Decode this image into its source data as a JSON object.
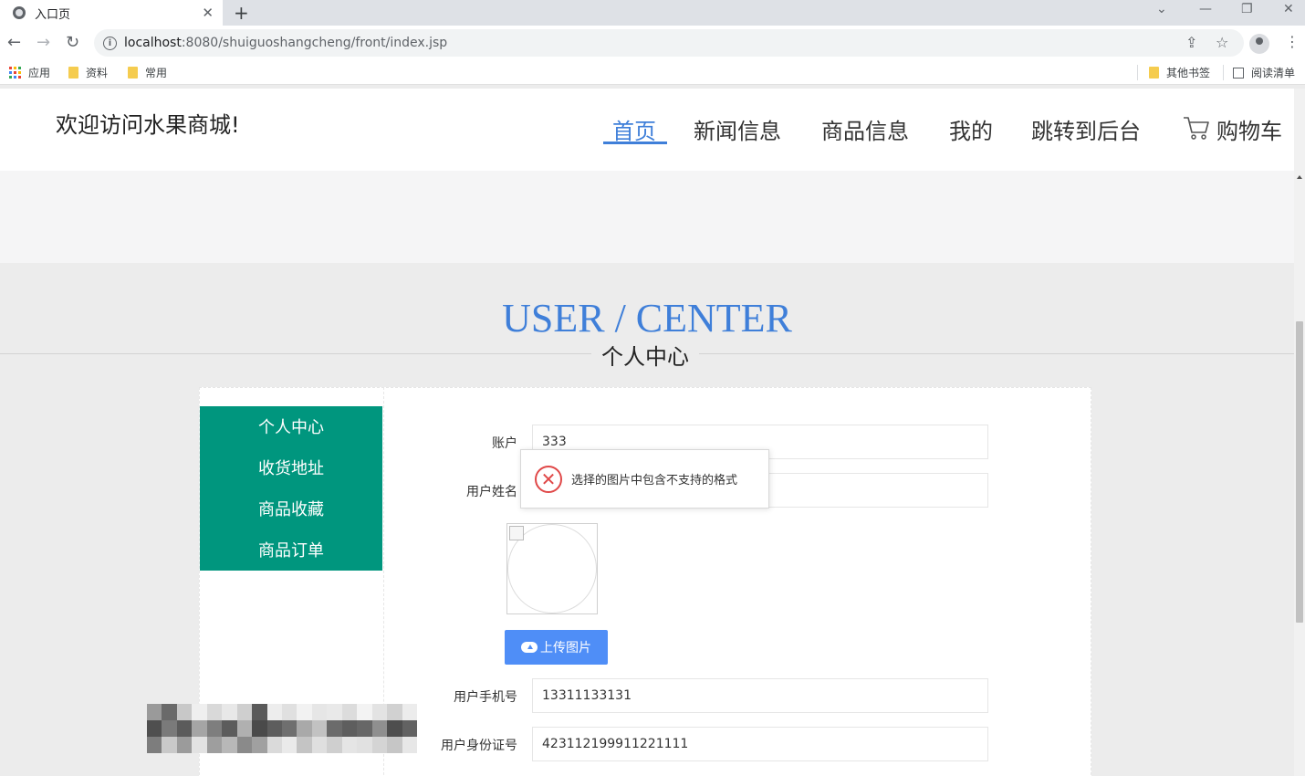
{
  "browser": {
    "tab_title": "入口页",
    "tab_close": "✕",
    "new_tab": "+",
    "url_host": "localhost",
    "url_path": ":8080/shuiguoshangcheng/front/index.jsp",
    "bookmarks": [
      "应用",
      "资料",
      "常用"
    ],
    "bookmark_other": "其他书签",
    "reading_list": "阅读清单"
  },
  "header": {
    "welcome": "欢迎访问水果商城!",
    "nav": [
      "首页",
      "新闻信息",
      "商品信息",
      "我的",
      "跳转到后台",
      "购物车"
    ],
    "active_index": 0,
    "accent": "#3f7fd9"
  },
  "section": {
    "title_en": "USER / CENTER",
    "title_cn": "个人中心"
  },
  "sidebar": {
    "items": [
      "个人中心",
      "收货地址",
      "商品收藏",
      "商品订单"
    ],
    "color": "#00967e"
  },
  "form": {
    "account_label": "账户",
    "account_value": "333",
    "name_label": "用户姓名",
    "name_value": "",
    "upload_label": "上传图片",
    "phone_label": "用户手机号",
    "phone_value": "13311133131",
    "id_label": "用户身份证号",
    "id_value": "423112199911221111"
  },
  "toast": {
    "message": "选择的图片中包含不支持的格式",
    "icon": "error-circle-icon"
  }
}
